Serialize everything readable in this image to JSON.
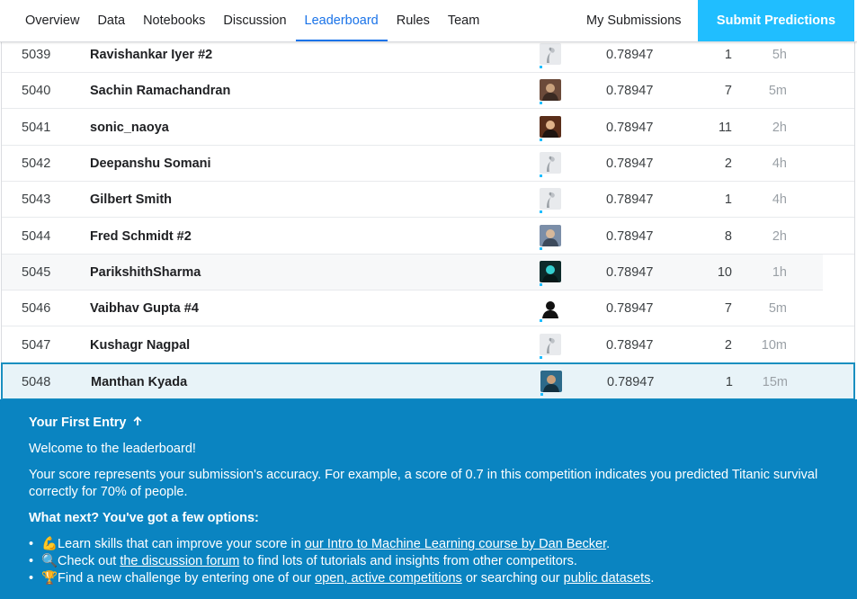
{
  "nav": {
    "tabs": [
      {
        "label": "Overview"
      },
      {
        "label": "Data"
      },
      {
        "label": "Notebooks"
      },
      {
        "label": "Discussion"
      },
      {
        "label": "Leaderboard",
        "active": true
      },
      {
        "label": "Rules"
      },
      {
        "label": "Team"
      }
    ],
    "my_submissions": "My Submissions",
    "submit_predictions": "Submit Predictions"
  },
  "colors": {
    "accent": "#20beff",
    "active_tab": "#1a73e8",
    "banner": "#0a84c1"
  },
  "leaderboard": {
    "rows": [
      {
        "rank": "5039",
        "team": "Ravishankar Iyer #2",
        "avatar": "default-avatar-icon",
        "score": "0.78947",
        "entries": "1",
        "last": "5h"
      },
      {
        "rank": "5040",
        "team": "Sachin Ramachandran",
        "avatar": "user-photo-avatar",
        "score": "0.78947",
        "entries": "7",
        "last": "5m"
      },
      {
        "rank": "5041",
        "team": "sonic_naoya",
        "avatar": "user-photo-avatar",
        "score": "0.78947",
        "entries": "11",
        "last": "2h"
      },
      {
        "rank": "5042",
        "team": "Deepanshu Somani",
        "avatar": "default-avatar-icon",
        "score": "0.78947",
        "entries": "2",
        "last": "4h"
      },
      {
        "rank": "5043",
        "team": "Gilbert Smith",
        "avatar": "default-avatar-icon",
        "score": "0.78947",
        "entries": "1",
        "last": "4h"
      },
      {
        "rank": "5044",
        "team": "Fred Schmidt #2",
        "avatar": "user-photo-avatar",
        "score": "0.78947",
        "entries": "8",
        "last": "2h"
      },
      {
        "rank": "5045",
        "team": "ParikshithSharma",
        "avatar": "user-photo-avatar",
        "score": "0.78947",
        "entries": "10",
        "last": "1h"
      },
      {
        "rank": "5046",
        "team": "Vaibhav Gupta #4",
        "avatar": "user-photo-avatar",
        "score": "0.78947",
        "entries": "7",
        "last": "5m"
      },
      {
        "rank": "5047",
        "team": "Kushagr Nagpal",
        "avatar": "default-avatar-icon",
        "score": "0.78947",
        "entries": "2",
        "last": "10m"
      },
      {
        "rank": "5048",
        "team": "Manthan Kyada",
        "avatar": "user-photo-avatar",
        "score": "0.78947",
        "entries": "1",
        "last": "15m",
        "highlighted": true
      }
    ]
  },
  "banner": {
    "title": "Your First Entry",
    "title_icon": "arrow-up-icon",
    "welcome": "Welcome to the leaderboard!",
    "paragraph": "Your score represents your submission's accuracy. For example, a score of 0.7 in this competition indicates you predicted Titanic survival correctly for 70% of people.",
    "next": "What next? You've got a few options:",
    "items": [
      {
        "emoji": "💪",
        "pre": "Learn skills that can improve your score in ",
        "link1": "our Intro to Machine Learning course by Dan Becker",
        "mid": ".",
        "link2": "",
        "post": ""
      },
      {
        "emoji": "🔍",
        "pre": "Check out ",
        "link1": "the discussion forum",
        "mid": " to find lots of tutorials and insights from other competitors.",
        "link2": "",
        "post": ""
      },
      {
        "emoji": "🏆",
        "pre": "Find a new challenge by entering one of our ",
        "link1": "open, active competitions",
        "mid": " or searching our ",
        "link2": "public datasets",
        "post": "."
      }
    ]
  }
}
